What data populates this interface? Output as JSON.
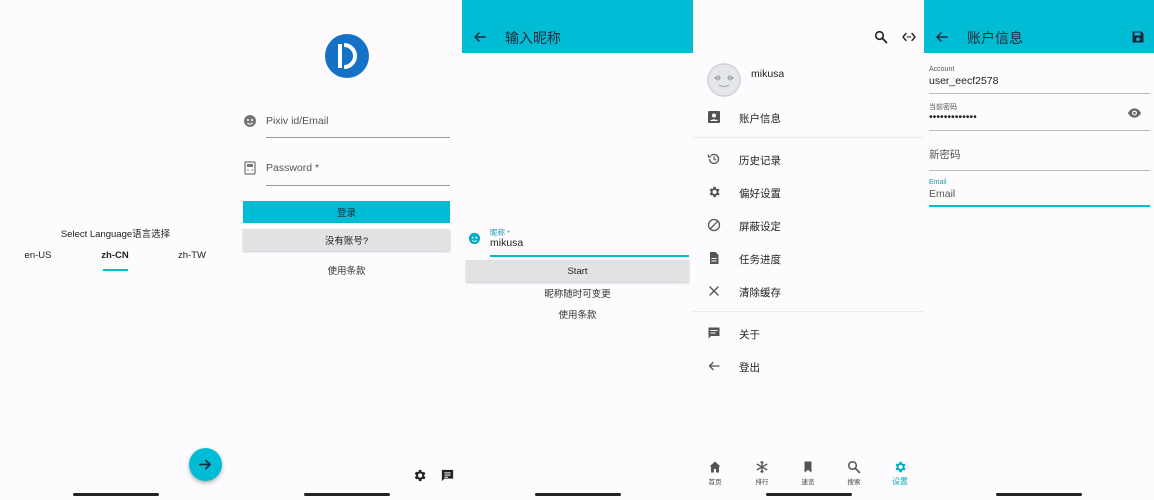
{
  "screen1": {
    "language_title": "Select Language语言选择",
    "languages": [
      "en-US",
      "zh-CN",
      "zh-TW"
    ],
    "selected_language": "zh-CN",
    "fab_icon": "arrow-right-icon"
  },
  "screen2": {
    "username_placeholder": "Pixiv id/Email",
    "password_placeholder": "Password *",
    "login_button": "登录",
    "no_account_button": "没有账号?",
    "terms_link": "使用条款",
    "bottom_icons": [
      "gear-icon",
      "feedback-icon"
    ]
  },
  "screen3": {
    "title": "输入昵称",
    "nickname_label": "昵称 *",
    "nickname_value": "mikusa",
    "start_button": "Start",
    "hint": "昵称随时可变更",
    "terms_link": "使用条款"
  },
  "screen4": {
    "top_icons": [
      "search-icon",
      "code-icon"
    ],
    "username": "mikusa",
    "menu": [
      "账户信息",
      "历史记录",
      "偏好设置",
      "屏蔽设定",
      "任务进度",
      "清除缓存",
      "关于",
      "登出"
    ],
    "bottom_nav": [
      "首页",
      "排行",
      "速览",
      "搜索",
      "设置"
    ],
    "active_nav": "设置"
  },
  "screen5": {
    "title": "账户信息",
    "account_label": "Account",
    "account_value": "user_eecf2578",
    "current_password_label": "当前密码",
    "current_password_value": "•••••••••••••",
    "new_password_placeholder": "新密码",
    "email_label": "Email",
    "email_placeholder": "Email"
  },
  "colors": {
    "accent": "#00bcd4",
    "logo": "#1471c6"
  }
}
